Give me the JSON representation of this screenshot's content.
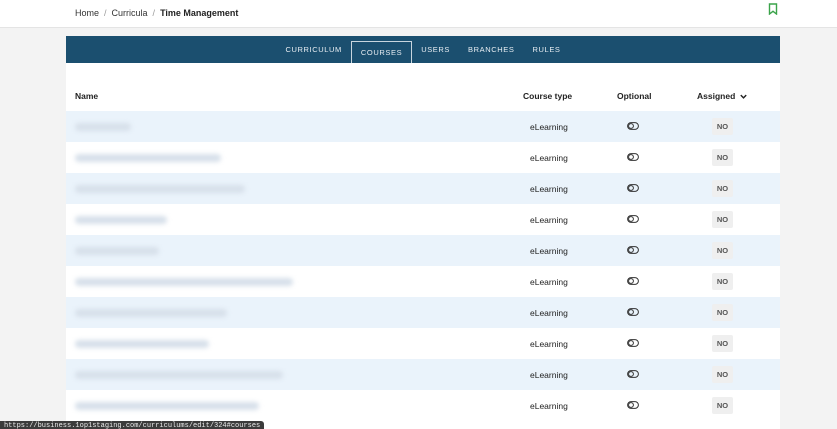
{
  "breadcrumb": {
    "home": "Home",
    "separator": "/",
    "curricula": "Curricula",
    "current": "Time Management"
  },
  "header": {
    "bookmark_icon": "bookmark-icon",
    "bookmark_color": "#3aa34a"
  },
  "tabs": [
    {
      "label": "CURRICULUM",
      "active": false
    },
    {
      "label": "COURSES",
      "active": true
    },
    {
      "label": "USERS",
      "active": false
    },
    {
      "label": "BRANCHES",
      "active": false
    },
    {
      "label": "RULES",
      "active": false
    }
  ],
  "table": {
    "columns": {
      "name": "Name",
      "course_type": "Course type",
      "optional": "Optional",
      "assigned": "Assigned"
    },
    "rows": [
      {
        "course_type": "eLearning",
        "assigned": "NO"
      },
      {
        "course_type": "eLearning",
        "assigned": "NO"
      },
      {
        "course_type": "eLearning",
        "assigned": "NO"
      },
      {
        "course_type": "eLearning",
        "assigned": "NO"
      },
      {
        "course_type": "eLearning",
        "assigned": "NO"
      },
      {
        "course_type": "eLearning",
        "assigned": "NO"
      },
      {
        "course_type": "eLearning",
        "assigned": "NO"
      },
      {
        "course_type": "eLearning",
        "assigned": "NO"
      },
      {
        "course_type": "eLearning",
        "assigned": "NO"
      },
      {
        "course_type": "eLearning",
        "assigned": "NO"
      }
    ]
  },
  "status_url": "https://business.1op1staging.com/curriculums/edit/324#courses",
  "colors": {
    "tab_bar": "#1b4f6f",
    "row_alt": "#eaf3fb"
  }
}
